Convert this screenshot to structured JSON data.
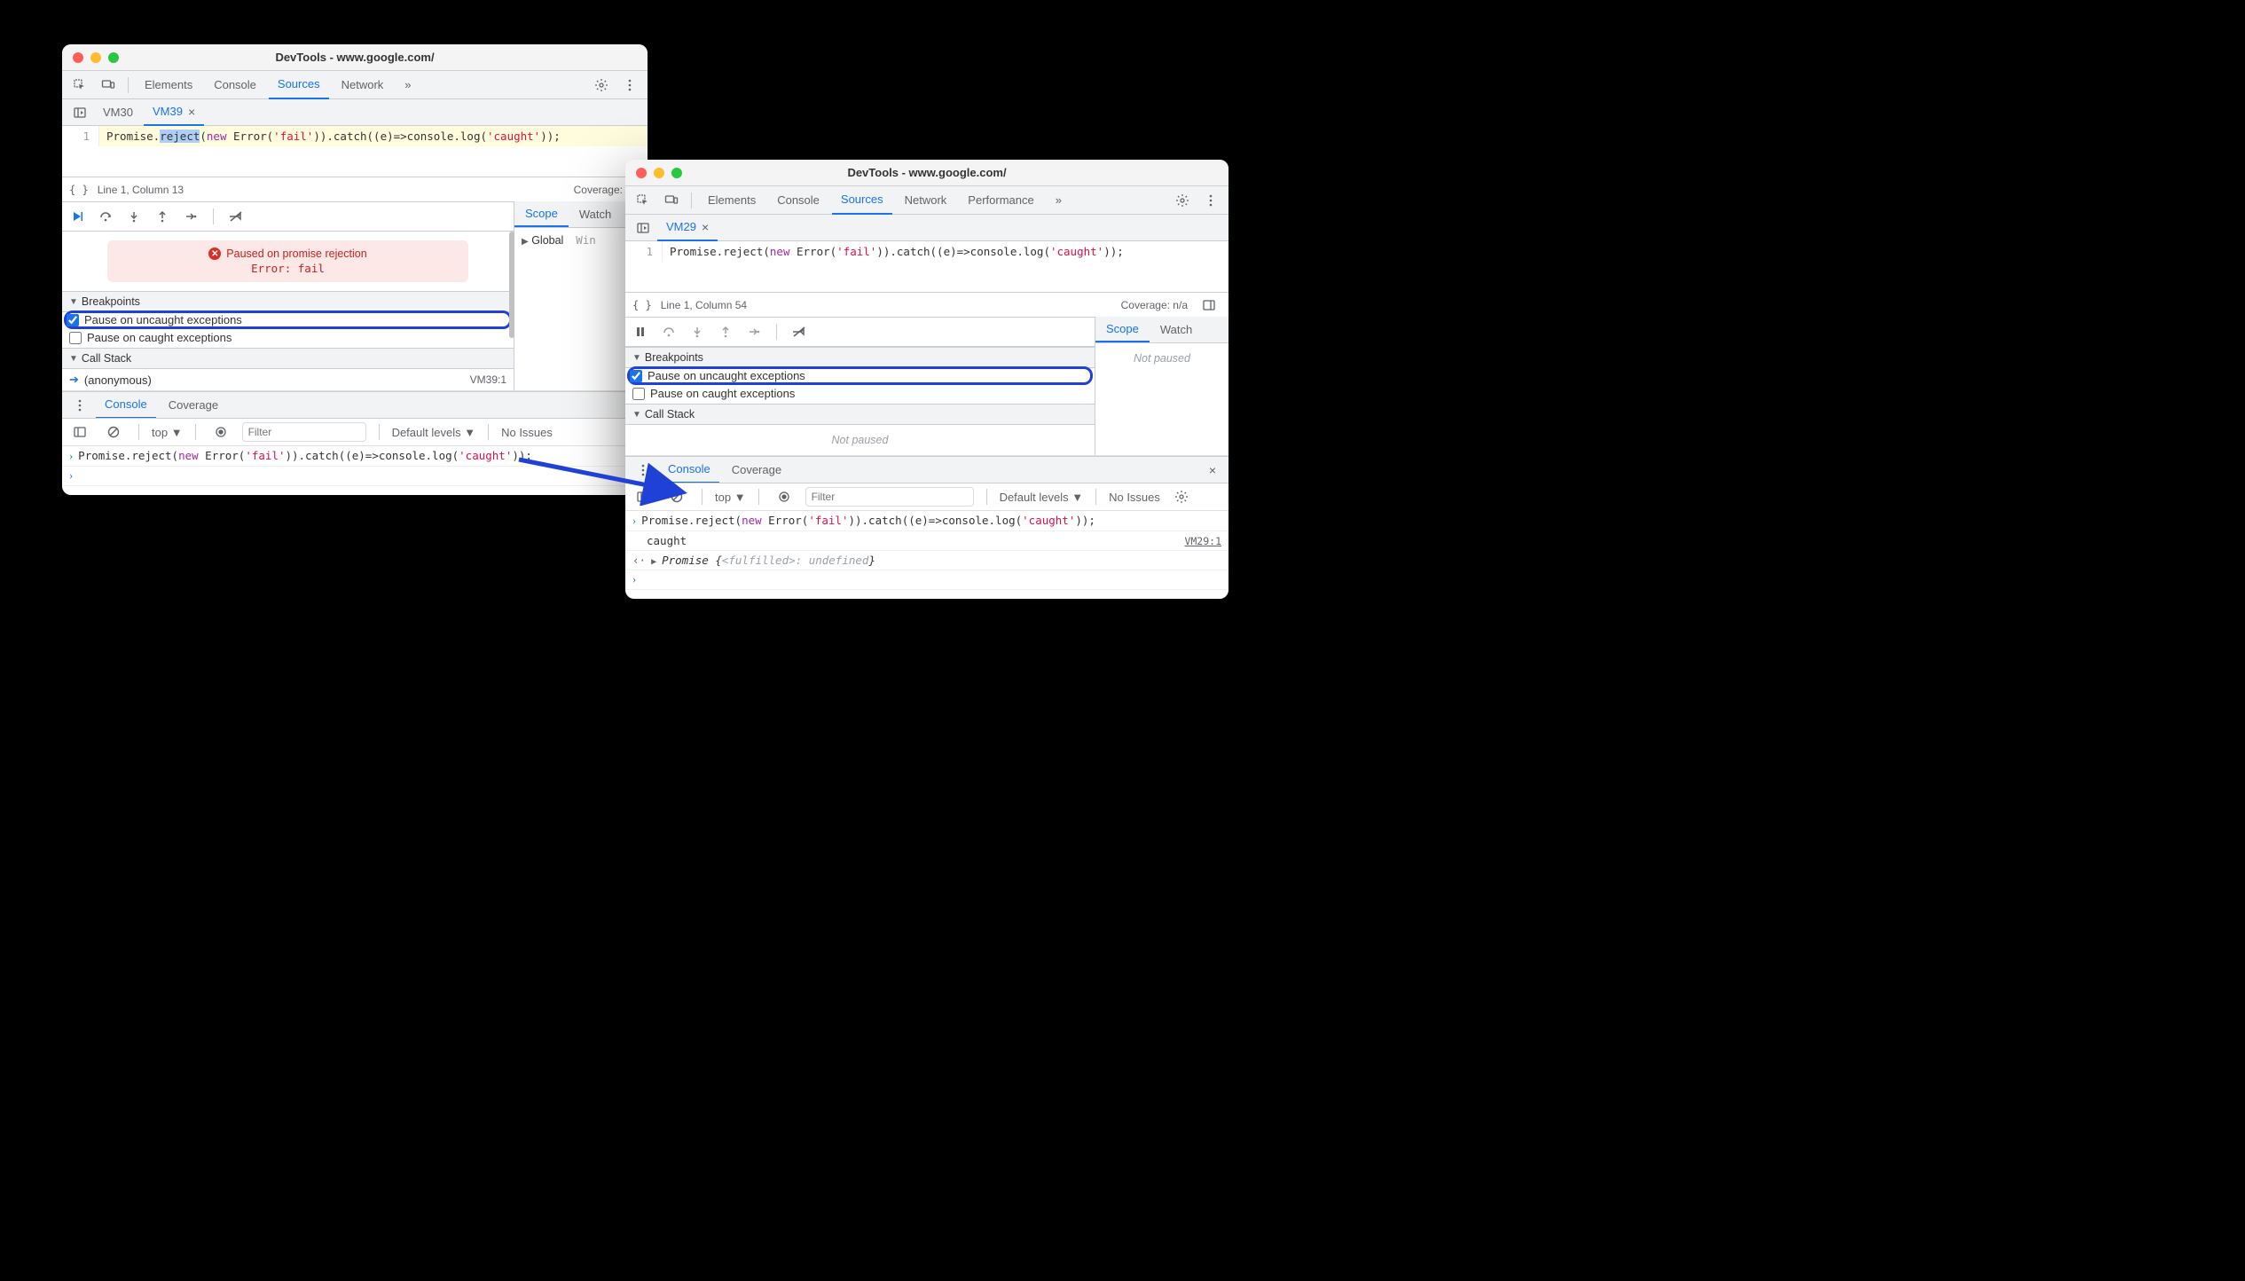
{
  "window1": {
    "title": "DevTools - www.google.com/",
    "topTabs": [
      "Elements",
      "Console",
      "Sources",
      "Network"
    ],
    "activeTopTab": "Sources",
    "moreGlyph": "»",
    "fileTabs": [
      "VM30",
      "VM39"
    ],
    "activeFileTab": "VM39",
    "code": {
      "lineNo": "1",
      "prefix": "Promise.",
      "sel": "reject",
      "paren1": "(",
      "newKw": "new",
      "space1": " ",
      "errorCall": "Error(",
      "str1": "'fail'",
      "close1": ")).catch((e)=>console.log(",
      "str2": "'caught'",
      "close2": "));"
    },
    "status": {
      "pretty": "{ }",
      "pos": "Line 1, Column 13",
      "coverage": "Coverage: n/a"
    },
    "pauseBox": {
      "title": "Paused on promise rejection",
      "detail": "Error: fail"
    },
    "breakpointsLabel": "Breakpoints",
    "pauseUncaught": "Pause on uncaught exceptions",
    "pauseCaught": "Pause on caught exceptions",
    "callStackLabel": "Call Stack",
    "stackFrame": "(anonymous)",
    "stackLoc": "VM39:1",
    "drawerTabs": [
      "Console",
      "Coverage"
    ],
    "activeDrawerTab": "Console",
    "consoleToolbar": {
      "context": "top",
      "filterPlaceholder": "Filter",
      "levels": "Default levels",
      "issues": "No Issues"
    },
    "consoleInput": {
      "prefix": "Promise.reject(",
      "newKw": "new",
      "mid": " Error(",
      "str1": "'fail'",
      "mid2": ")).catch((e)=>console.log(",
      "str2": "'caught'",
      "end": "));"
    },
    "scopeTabs": [
      "Scope",
      "Watch"
    ],
    "activeScopeTab": "Scope",
    "scopeGlobal": "Global",
    "scopeWin": "Win"
  },
  "window2": {
    "title": "DevTools - www.google.com/",
    "topTabs": [
      "Elements",
      "Console",
      "Sources",
      "Network",
      "Performance"
    ],
    "activeTopTab": "Sources",
    "moreGlyph": "»",
    "fileTabs": [
      "VM29"
    ],
    "activeFileTab": "VM29",
    "code": {
      "lineNo": "1",
      "prefix": "Promise.reject(",
      "newKw": "new",
      "space1": " ",
      "errorCall": "Error(",
      "str1": "'fail'",
      "close1": ")).catch((e)=>console.log(",
      "str2": "'caught'",
      "close2": "));"
    },
    "status": {
      "pretty": "{ }",
      "pos": "Line 1, Column 54",
      "coverage": "Coverage: n/a"
    },
    "breakpointsLabel": "Breakpoints",
    "pauseUncaught": "Pause on uncaught exceptions",
    "pauseCaught": "Pause on caught exceptions",
    "callStackLabel": "Call Stack",
    "notPaused": "Not paused",
    "drawerTabs": [
      "Console",
      "Coverage"
    ],
    "activeDrawerTab": "Console",
    "consoleToolbar": {
      "context": "top",
      "filterPlaceholder": "Filter",
      "levels": "Default levels",
      "issues": "No Issues"
    },
    "consoleInput": {
      "prefix": "Promise.reject(",
      "newKw": "new",
      "mid": " Error(",
      "str1": "'fail'",
      "mid2": ")).catch((e)=>console.log(",
      "str2": "'caught'",
      "end": "));"
    },
    "consoleLog": "caught",
    "consoleLogLoc": "VM29:1",
    "consoleReturn": {
      "lead": "Promise ",
      "open": "{",
      "state": "<fulfilled>",
      "sep": ": ",
      "value": "undefined",
      "close": "}"
    },
    "scopeTabs": [
      "Scope",
      "Watch"
    ],
    "activeScopeTab": "Scope",
    "scopeNotPaused": "Not paused"
  }
}
